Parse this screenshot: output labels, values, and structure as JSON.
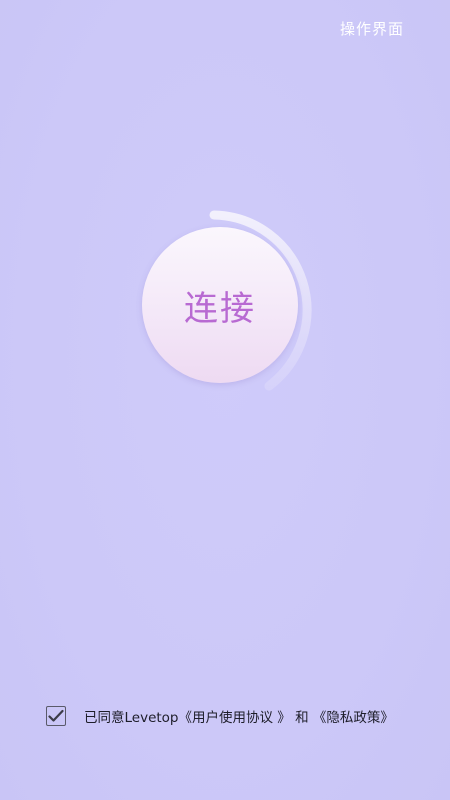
{
  "header": {
    "operation_link": "操作界面"
  },
  "main": {
    "connect_label": "连接"
  },
  "agreement": {
    "checked": true,
    "prefix": "已同意Levetop",
    "user_agreement": "《用户使用协议 》",
    "and_text": "和",
    "privacy_policy": "《隐私政策》"
  },
  "colors": {
    "background": "#ccc8f8",
    "connect_text": "#b86ad2",
    "button_top": "#fbf7fd",
    "button_bottom": "#eedaf2",
    "link_text": "#ffffff"
  },
  "icons": {
    "checkbox": "check-icon"
  }
}
